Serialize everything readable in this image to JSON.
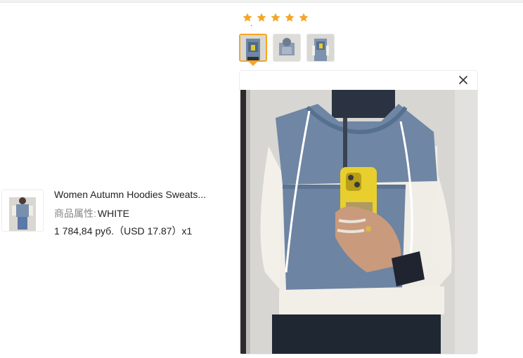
{
  "rating": {
    "stars": 5,
    "max": 5,
    "color": "#f5a623"
  },
  "gallery": {
    "thumbnails": [
      {
        "icon": "review-photo-1",
        "selected": true
      },
      {
        "icon": "review-photo-2",
        "selected": false
      },
      {
        "icon": "review-photo-3",
        "selected": false
      }
    ],
    "accent": "#f5a623"
  },
  "preview": {
    "close_icon": "close-icon"
  },
  "product": {
    "title": "Women Autumn Hoodies Sweats...",
    "attr_label": "商品属性:",
    "attr_value": "WHITE",
    "price": "1 784,84 руб.（USD  17.87）x1",
    "thumb_icon": "product-photo"
  }
}
